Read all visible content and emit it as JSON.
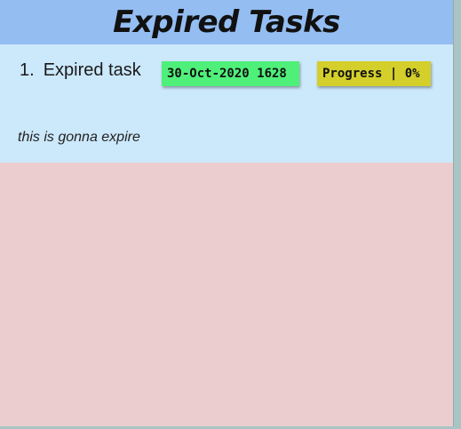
{
  "page_title": "Expired Tasks",
  "tasks": [
    {
      "index": "1.",
      "title": "Expired task",
      "due": "30-Oct-2020 1628",
      "progress": "Progress | 0%",
      "description": "this is gonna expire"
    }
  ],
  "colors": {
    "header_bg": "#94bdf2",
    "task_bg": "#cce8fb",
    "panel_bg": "#ebcdd0",
    "date_badge": "#4ff07a",
    "progress_badge": "#d4cf2a"
  }
}
